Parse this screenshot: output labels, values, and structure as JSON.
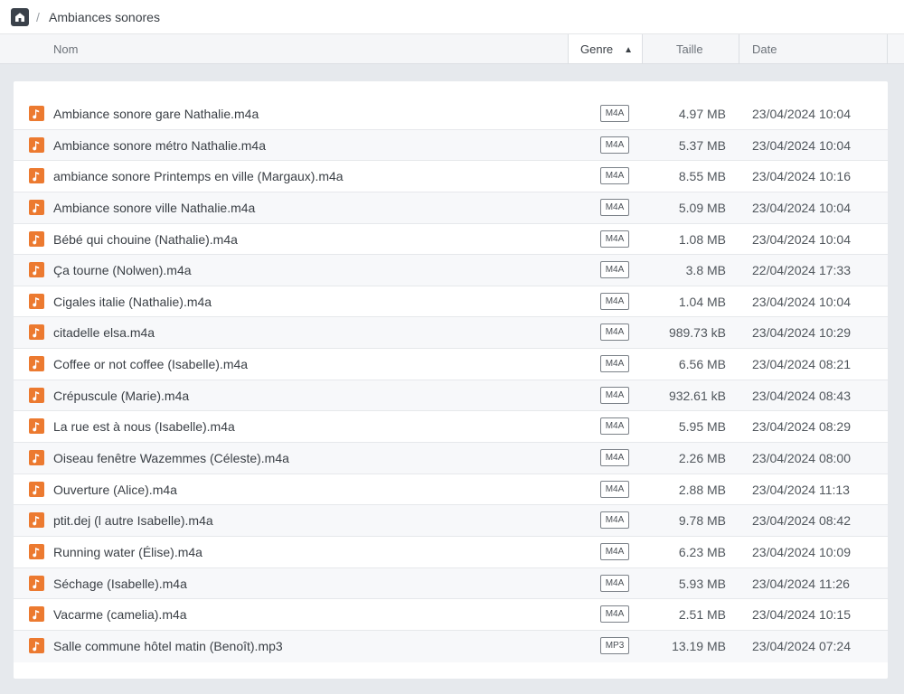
{
  "breadcrumb": {
    "home_icon": "home-folder-icon",
    "separator": "/",
    "current": "Ambiances sonores"
  },
  "columns": {
    "name": "Nom",
    "type": "Genre",
    "type_sort_icon": "chevron-up-icon",
    "size": "Taille",
    "date": "Date"
  },
  "colors": {
    "file_icon": "#ec7a30",
    "home_icon_bg": "#3a414a",
    "page_bg": "#e6e9ed"
  },
  "files": [
    {
      "name": "Ambiance sonore gare Nathalie.m4a",
      "type": "M4A",
      "size": "4.97 MB",
      "date": "23/04/2024 10:04"
    },
    {
      "name": "Ambiance sonore métro Nathalie.m4a",
      "type": "M4A",
      "size": "5.37 MB",
      "date": "23/04/2024 10:04"
    },
    {
      "name": "ambiance sonore Printemps en ville (Margaux).m4a",
      "type": "M4A",
      "size": "8.55 MB",
      "date": "23/04/2024 10:16"
    },
    {
      "name": "Ambiance sonore ville Nathalie.m4a",
      "type": "M4A",
      "size": "5.09 MB",
      "date": "23/04/2024 10:04"
    },
    {
      "name": "Bébé qui chouine (Nathalie).m4a",
      "type": "M4A",
      "size": "1.08 MB",
      "date": "23/04/2024 10:04"
    },
    {
      "name": "Ça tourne (Nolwen).m4a",
      "type": "M4A",
      "size": "3.8 MB",
      "date": "22/04/2024 17:33"
    },
    {
      "name": "Cigales italie (Nathalie).m4a",
      "type": "M4A",
      "size": "1.04 MB",
      "date": "23/04/2024 10:04"
    },
    {
      "name": "citadelle elsa.m4a",
      "type": "M4A",
      "size": "989.73 kB",
      "date": "23/04/2024 10:29"
    },
    {
      "name": "Coffee or not coffee (Isabelle).m4a",
      "type": "M4A",
      "size": "6.56 MB",
      "date": "23/04/2024 08:21"
    },
    {
      "name": "Crépuscule (Marie).m4a",
      "type": "M4A",
      "size": "932.61 kB",
      "date": "23/04/2024 08:43"
    },
    {
      "name": "La rue est à nous (Isabelle).m4a",
      "type": "M4A",
      "size": "5.95 MB",
      "date": "23/04/2024 08:29"
    },
    {
      "name": "Oiseau fenêtre Wazemmes (Céleste).m4a",
      "type": "M4A",
      "size": "2.26 MB",
      "date": "23/04/2024 08:00"
    },
    {
      "name": "Ouverture (Alice).m4a",
      "type": "M4A",
      "size": "2.88 MB",
      "date": "23/04/2024 11:13"
    },
    {
      "name": "ptit.dej (l autre Isabelle).m4a",
      "type": "M4A",
      "size": "9.78 MB",
      "date": "23/04/2024 08:42"
    },
    {
      "name": "Running water (Élise).m4a",
      "type": "M4A",
      "size": "6.23 MB",
      "date": "23/04/2024 10:09"
    },
    {
      "name": "Séchage (Isabelle).m4a",
      "type": "M4A",
      "size": "5.93 MB",
      "date": "23/04/2024 11:26"
    },
    {
      "name": "Vacarme (camelia).m4a",
      "type": "M4A",
      "size": "2.51 MB",
      "date": "23/04/2024 10:15"
    },
    {
      "name": "Salle commune hôtel matin (Benoît).mp3",
      "type": "MP3",
      "size": "13.19 MB",
      "date": "23/04/2024 07:24"
    }
  ]
}
